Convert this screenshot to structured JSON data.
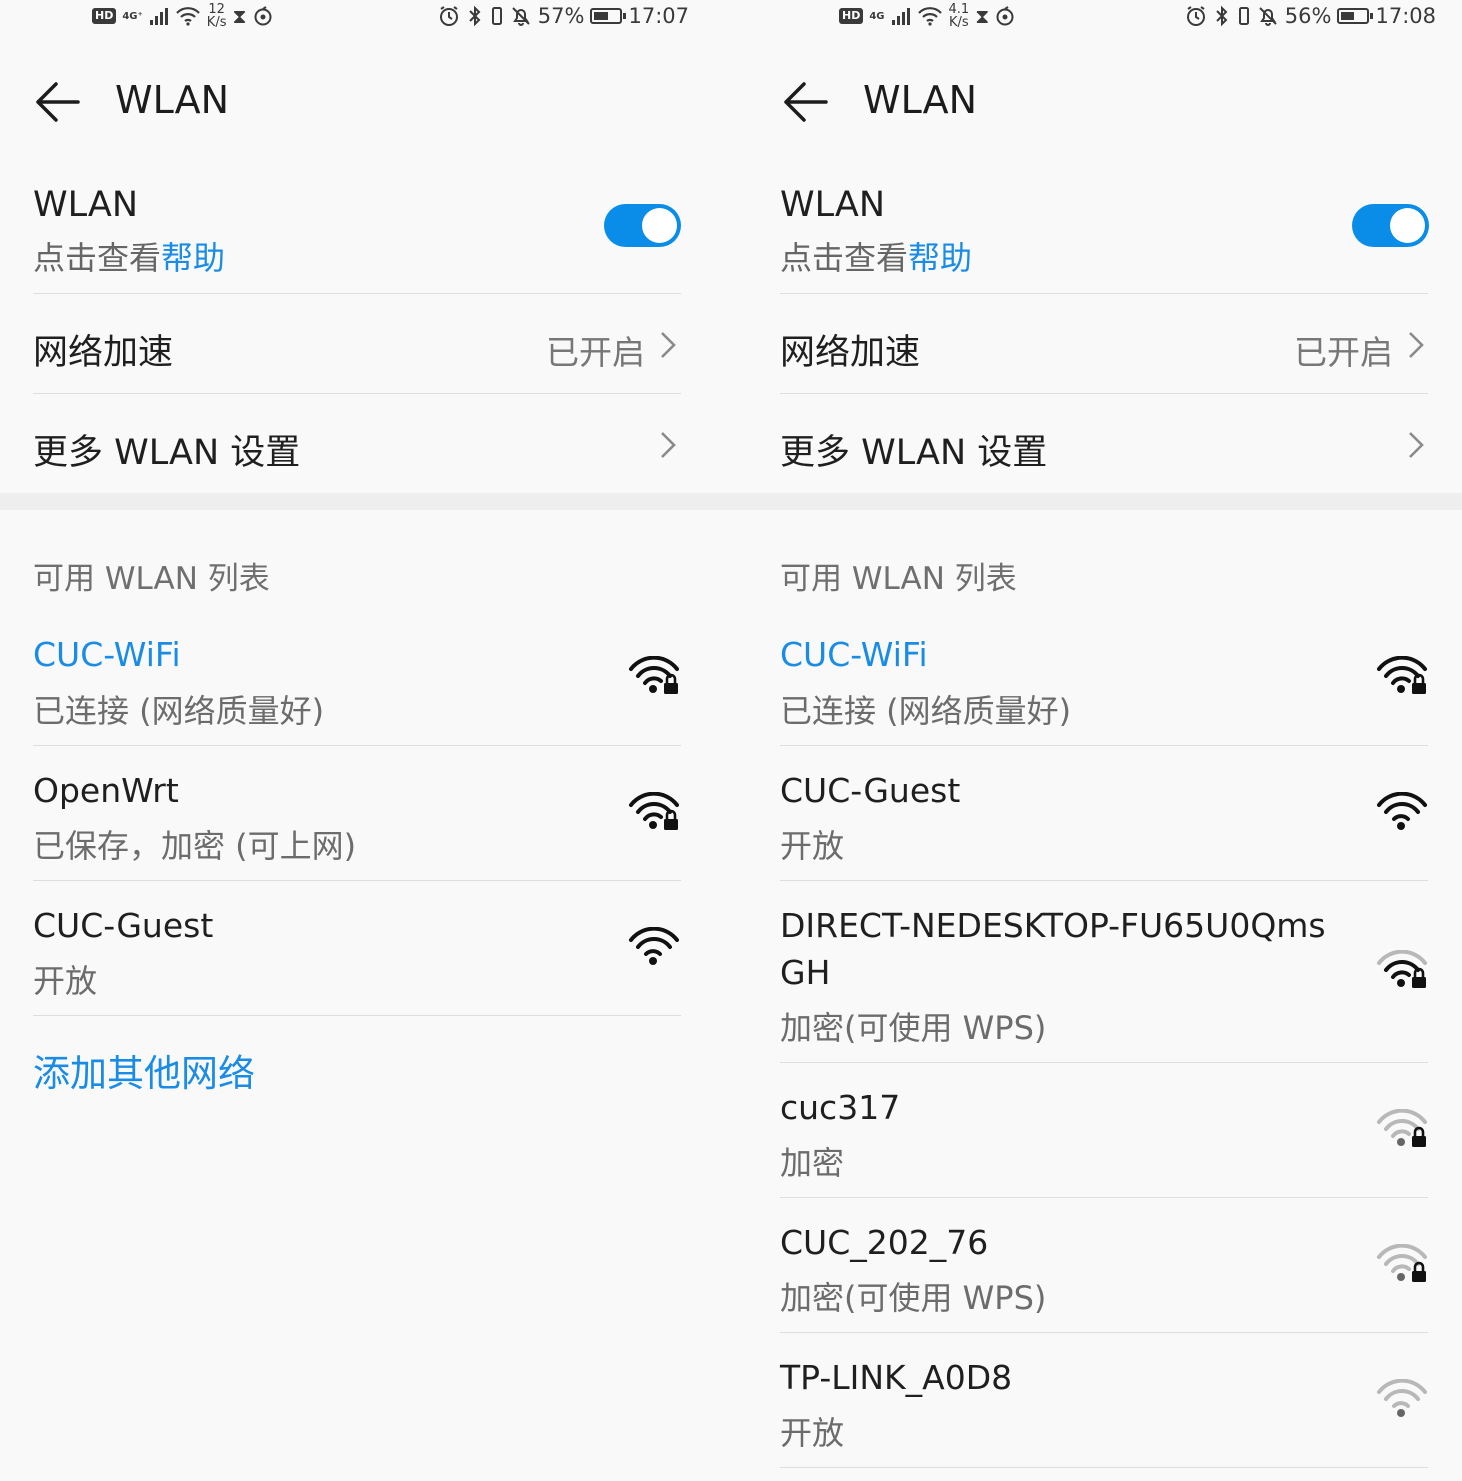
{
  "left": {
    "status": {
      "hd": "HD",
      "signal": "4G⁺",
      "speed_value": "12",
      "speed_unit": "K/s",
      "battery_pct": "57%",
      "battery_level": 0.57,
      "time": "17:07"
    },
    "header": {
      "title": "WLAN"
    },
    "wlan_row": {
      "title": "WLAN",
      "sub_prefix": "点击查看",
      "sub_link": "帮助",
      "toggle_on": true
    },
    "settings": [
      {
        "label": "网络加速",
        "value": "已开启"
      },
      {
        "label": "更多 WLAN 设置",
        "value": ""
      }
    ],
    "section_title": "可用 WLAN 列表",
    "networks": [
      {
        "name": "CUC-WiFi",
        "status": "已连接 (网络质量好)",
        "secured": true,
        "signal": 4,
        "connected": true
      },
      {
        "name": "OpenWrt",
        "status": "已保存，加密 (可上网)",
        "secured": true,
        "signal": 4,
        "connected": false
      },
      {
        "name": "CUC-Guest",
        "status": "开放",
        "secured": false,
        "signal": 4,
        "connected": false
      }
    ],
    "add_network": "添加其他网络"
  },
  "right": {
    "status": {
      "hd": "HD",
      "signal": "4G",
      "speed_value": "4.1",
      "speed_unit": "K/s",
      "battery_pct": "56%",
      "battery_level": 0.56,
      "time": "17:08"
    },
    "header": {
      "title": "WLAN"
    },
    "wlan_row": {
      "title": "WLAN",
      "sub_prefix": "点击查看",
      "sub_link": "帮助",
      "toggle_on": true
    },
    "settings": [
      {
        "label": "网络加速",
        "value": "已开启"
      },
      {
        "label": "更多 WLAN 设置",
        "value": ""
      }
    ],
    "section_title": "可用 WLAN 列表",
    "networks": [
      {
        "name": "CUC-WiFi",
        "status": "已连接 (网络质量好)",
        "secured": true,
        "signal": 4,
        "connected": true
      },
      {
        "name": "CUC-Guest",
        "status": "开放",
        "secured": false,
        "signal": 4,
        "connected": false
      },
      {
        "name": "DIRECT-NEDESKTOP-FU65U0Qms",
        "name2": "GH",
        "status": "加密(可使用 WPS)",
        "secured": true,
        "signal": 3,
        "connected": false
      },
      {
        "name": "cuc317",
        "status": "加密",
        "secured": true,
        "signal": 1,
        "connected": false
      },
      {
        "name": "CUC_202_76",
        "status": "加密(可使用 WPS)",
        "secured": true,
        "signal": 1,
        "connected": false
      },
      {
        "name": "TP-LINK_A0D8",
        "status": "开放",
        "secured": false,
        "signal": 1,
        "connected": false
      }
    ]
  },
  "colors": {
    "accent": "#1a8ce6",
    "toggle": "#0a8de8",
    "text": "#1f1f1f",
    "secondary": "#6c6c6c",
    "divider": "#dedede"
  }
}
